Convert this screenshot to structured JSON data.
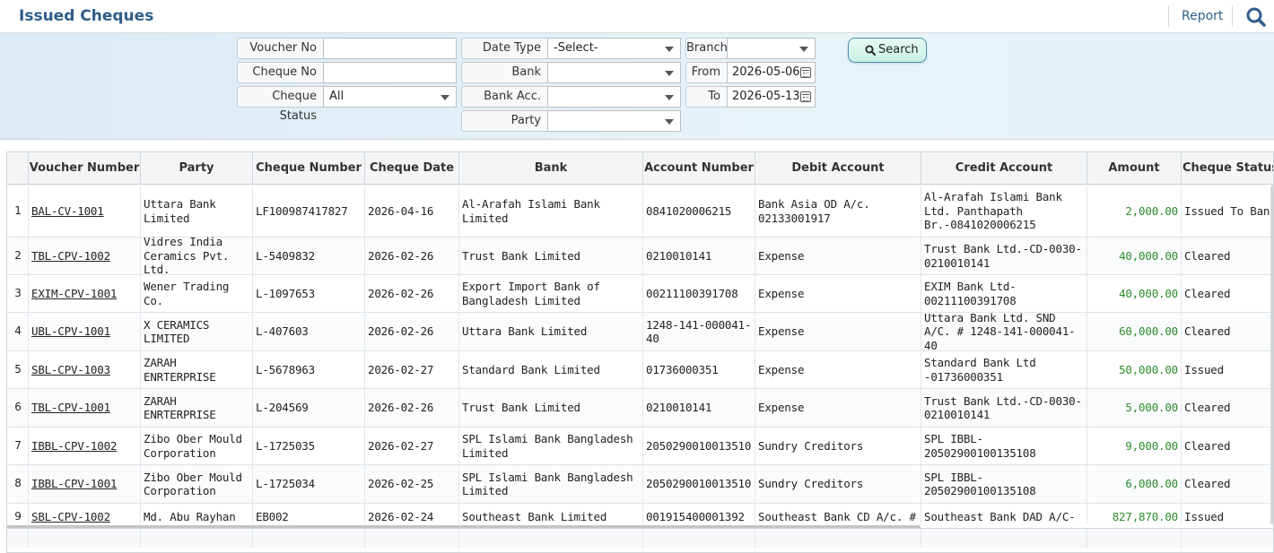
{
  "header": {
    "title": "Issued Cheques",
    "report_label": "Report",
    "search_icon": "search-icon"
  },
  "filters": {
    "voucher_no_label": "Voucher No",
    "voucher_no_value": "",
    "cheque_no_label": "Cheque No",
    "cheque_no_value": "",
    "cheque_status_label": "Cheque Status",
    "cheque_status_value": "All",
    "date_type_label": "Date Type",
    "date_type_value": "-Select-",
    "bank_label": "Bank",
    "bank_value": "",
    "bank_acc_label": "Bank Acc.",
    "bank_acc_value": "",
    "party_label": "Party",
    "party_value": "",
    "branch_label": "Branch",
    "branch_value": "",
    "from_label": "From",
    "from_value": "2026-05-06",
    "to_label": "To",
    "to_value": "2026-05-13",
    "search_button": "Search"
  },
  "table": {
    "columns": [
      "Voucher Number",
      "Party",
      "Cheque Number",
      "Cheque Date",
      "Bank",
      "Account Number",
      "Debit Account",
      "Credit Account",
      "Amount",
      "Cheque Status"
    ],
    "rows": [
      {
        "n": "1",
        "voucher": "BAL-CV-1001",
        "party": "Uttara Bank Limited",
        "cheque": "LF100987417827",
        "date": "2026-04-16",
        "bank": "Al-Arafah Islami Bank Limited",
        "account": "0841020006215",
        "debit": "Bank Asia OD A/c. 02133001917",
        "credit": "Al-Arafah Islami Bank Ltd. Panthapath Br.-0841020006215",
        "amount": "2,000.00",
        "status": "Issued To Bank"
      },
      {
        "n": "2",
        "voucher": "TBL-CPV-1002",
        "party": "Vidres India Ceramics Pvt. Ltd.",
        "cheque": "L-5409832",
        "date": "2026-02-26",
        "bank": "Trust Bank Limited",
        "account": "0210010141",
        "debit": "Expense",
        "credit": "Trust Bank Ltd.-CD-0030-0210010141",
        "amount": "40,000.00",
        "status": "Cleared"
      },
      {
        "n": "3",
        "voucher": "EXIM-CPV-1001",
        "party": "Wener Trading Co.",
        "cheque": "L-1097653",
        "date": "2026-02-26",
        "bank": "Export Import Bank of Bangladesh Limited",
        "account": "00211100391708",
        "debit": "Expense",
        "credit": "EXIM Bank Ltd-00211100391708",
        "amount": "40,000.00",
        "status": "Cleared"
      },
      {
        "n": "4",
        "voucher": "UBL-CPV-1001",
        "party": "X CERAMICS LIMITED",
        "cheque": "L-407603",
        "date": "2026-02-26",
        "bank": "Uttara Bank Limited",
        "account": "1248-141-000041-40",
        "debit": "Expense",
        "credit": "Uttara Bank Ltd. SND A/C. # 1248-141-000041-40",
        "amount": "60,000.00",
        "status": "Cleared"
      },
      {
        "n": "5",
        "voucher": "SBL-CPV-1003",
        "party": "ZARAH ENRTERPRISE",
        "cheque": "L-5678963",
        "date": "2026-02-27",
        "bank": "Standard Bank Limited",
        "account": "01736000351",
        "debit": "Expense",
        "credit": "Standard Bank Ltd -01736000351",
        "amount": "50,000.00",
        "status": "Issued"
      },
      {
        "n": "6",
        "voucher": "TBL-CPV-1001",
        "party": "ZARAH ENRTERPRISE",
        "cheque": "L-204569",
        "date": "2026-02-26",
        "bank": "Trust Bank Limited",
        "account": "0210010141",
        "debit": "Expense",
        "credit": "Trust Bank Ltd.-CD-0030-0210010141",
        "amount": "5,000.00",
        "status": "Cleared"
      },
      {
        "n": "7",
        "voucher": "IBBL-CPV-1002",
        "party": "Zibo Ober Mould Corporation",
        "cheque": "L-1725035",
        "date": "2026-02-27",
        "bank": "SPL Islami Bank Bangladesh Limited",
        "account": "2050290010013510",
        "debit": "Sundry Creditors",
        "credit": "SPL IBBL-20502900100135108",
        "amount": "9,000.00",
        "status": "Cleared"
      },
      {
        "n": "8",
        "voucher": "IBBL-CPV-1001",
        "party": "Zibo Ober Mould Corporation",
        "cheque": "L-1725034",
        "date": "2026-02-25",
        "bank": "SPL Islami Bank Bangladesh Limited",
        "account": "2050290010013510",
        "debit": "Sundry Creditors",
        "credit": "SPL IBBL-20502900100135108",
        "amount": "6,000.00",
        "status": "Cleared"
      },
      {
        "n": "9",
        "voucher": "SBL-CPV-1002",
        "party": "Md. Abu Rayhan",
        "cheque": "EB002",
        "date": "2026-02-24",
        "bank": "Southeast Bank Limited",
        "account": "001915400001392",
        "debit": "Southeast  Bank CD A/c. #",
        "credit": "Southeast Bank DAD A/C-",
        "amount": "827,870.00",
        "status": "Issued"
      }
    ]
  }
}
